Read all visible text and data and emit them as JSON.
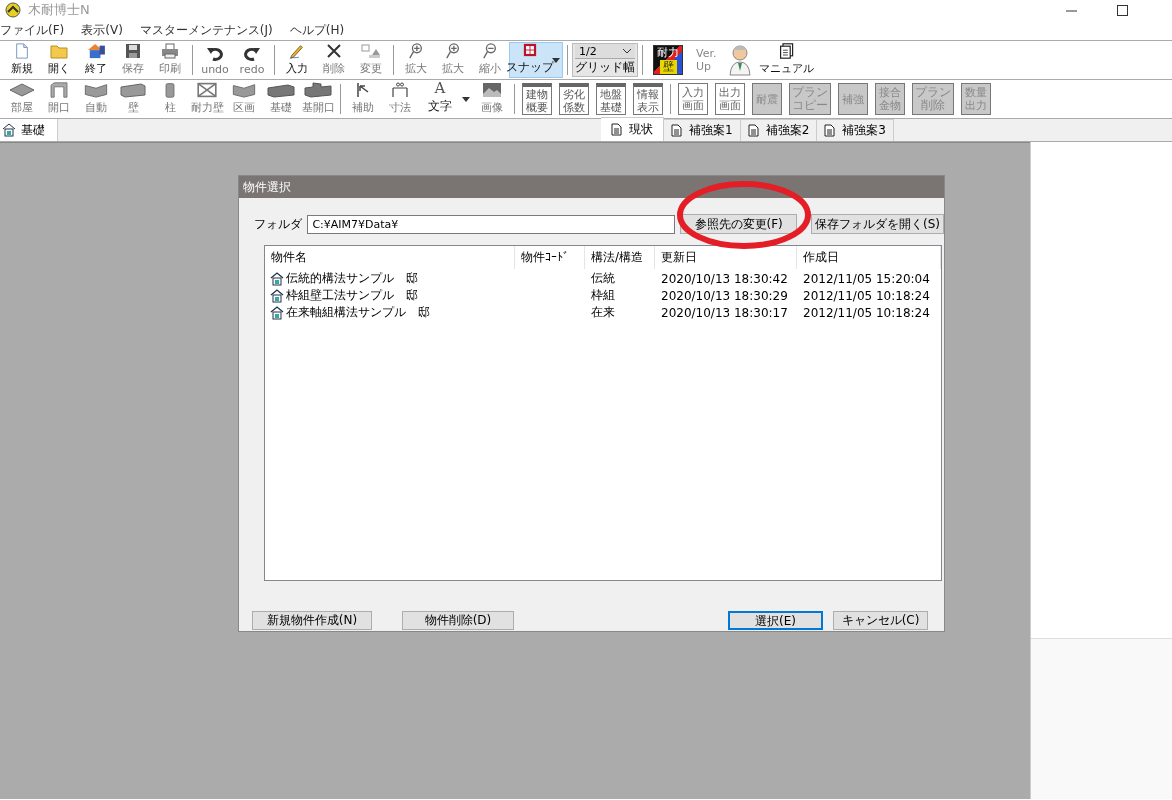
{
  "window": {
    "title": "木耐博士N"
  },
  "menu": [
    "ファイル(F)",
    "表示(V)",
    "マスターメンテナンス(J)",
    "ヘルプ(H)"
  ],
  "toolbar": [
    [
      {
        "kind": "tool",
        "label": "新規",
        "disabled": false
      },
      {
        "kind": "tool",
        "label": "開く",
        "disabled": false
      },
      {
        "kind": "tool",
        "label": "終了",
        "disabled": false
      },
      {
        "kind": "tool",
        "label": "保存",
        "disabled": true
      },
      {
        "kind": "tool",
        "label": "印刷",
        "disabled": true
      }
    ],
    [
      {
        "kind": "tool",
        "label": "undo",
        "disabled": true
      },
      {
        "kind": "tool",
        "label": "redo",
        "disabled": true
      }
    ],
    [
      {
        "kind": "tool",
        "label": "入力",
        "disabled": false
      },
      {
        "kind": "tool",
        "label": "削除",
        "disabled": true
      },
      {
        "kind": "tool",
        "label": "変更",
        "disabled": true
      }
    ],
    [
      {
        "kind": "tool",
        "label": "拡大",
        "disabled": true
      },
      {
        "kind": "tool",
        "label": "拡大",
        "disabled": true
      },
      {
        "kind": "tool",
        "label": "縮小",
        "disabled": true
      },
      {
        "kind": "split",
        "label": "スナップ",
        "pressed": true
      }
    ],
    [
      {
        "kind": "combo",
        "value": "1/2",
        "label": "グリッド幅"
      }
    ],
    [
      {
        "kind": "logo",
        "lines": [
          "耐力",
          "壁"
        ]
      },
      {
        "kind": "text",
        "lines": [
          "Ver.",
          "Up"
        ],
        "disabled": true
      },
      {
        "kind": "figure"
      },
      {
        "kind": "tool",
        "label": "マニュアル",
        "disabled": false
      }
    ]
  ],
  "toolbar2": [
    [
      {
        "kind": "tool",
        "label": "部屋",
        "disabled": true
      },
      {
        "kind": "tool",
        "label": "開口",
        "disabled": true
      },
      {
        "kind": "tool",
        "label": "自動",
        "disabled": true
      },
      {
        "kind": "tool",
        "label": "壁",
        "disabled": true
      },
      {
        "kind": "tool",
        "label": "柱",
        "disabled": true
      },
      {
        "kind": "tool",
        "label": "耐力壁",
        "disabled": true
      },
      {
        "kind": "tool",
        "label": "区画",
        "disabled": true
      },
      {
        "kind": "tool",
        "label": "基礎",
        "disabled": true
      },
      {
        "kind": "tool",
        "label": "基開口",
        "disabled": true
      }
    ],
    [
      {
        "kind": "tool",
        "label": "補助",
        "disabled": true
      },
      {
        "kind": "tool",
        "label": "寸法",
        "disabled": true
      },
      {
        "kind": "split",
        "label": "文字",
        "glyph": "A",
        "pressed": false
      },
      {
        "kind": "tool",
        "label": "画像",
        "disabled": true
      }
    ],
    [
      {
        "kind": "boxed",
        "label": "建物概要"
      },
      {
        "kind": "boxed",
        "label": "劣化係数"
      },
      {
        "kind": "boxed",
        "label": "地盤基礎"
      },
      {
        "kind": "boxed",
        "label": "情報表示"
      }
    ],
    [
      {
        "kind": "outline",
        "label": "入力画面"
      },
      {
        "kind": "outline",
        "label": "出力画面"
      },
      {
        "kind": "grey",
        "label": "耐震"
      },
      {
        "kind": "grey",
        "label": "プランコピー"
      },
      {
        "kind": "grey",
        "label": "補強"
      },
      {
        "kind": "grey",
        "label": "接合金物"
      },
      {
        "kind": "grey",
        "label": "プラン削除"
      },
      {
        "kind": "grey",
        "label": "数量出力"
      }
    ]
  ],
  "left_tab": {
    "label": "基礎"
  },
  "plan_tabs": [
    {
      "label": "現状",
      "selected": true
    },
    {
      "label": "補強案1",
      "selected": false
    },
    {
      "label": "補強案2",
      "selected": false
    },
    {
      "label": "補強案3",
      "selected": false
    }
  ],
  "dialog": {
    "title": "物件選択",
    "folder_label": "フォルダ",
    "folder_value": "C:¥AIM7¥Data¥",
    "folder_buttons": [
      "参照先の変更(F)",
      "保存フォルダを開く(S)"
    ],
    "columns": [
      "物件名",
      "物件ｺｰﾄﾞ",
      "構法/構造",
      "更新日",
      "作成日"
    ],
    "rows": [
      {
        "name": "伝統的構法サンプル　邸",
        "structure": "伝統",
        "updated": "2020/10/13 18:30:42",
        "created": "2012/11/05 15:20:04"
      },
      {
        "name": "枠組壁工法サンプル　邸",
        "structure": "枠組",
        "updated": "2020/10/13 18:30:29",
        "created": "2012/11/05 10:18:24"
      },
      {
        "name": "在来軸組構法サンプル　邸",
        "structure": "在来",
        "updated": "2020/10/13 18:30:17",
        "created": "2012/11/05 10:18:24"
      }
    ],
    "buttons": [
      {
        "label": "新規物件作成(N)",
        "default": false
      },
      {
        "label": "物件削除(D)",
        "default": false
      },
      {
        "label": "選択(E)",
        "default": true
      },
      {
        "label": "キャンセル(C)",
        "default": false
      }
    ]
  },
  "annotation": {
    "kind": "ellipse"
  }
}
